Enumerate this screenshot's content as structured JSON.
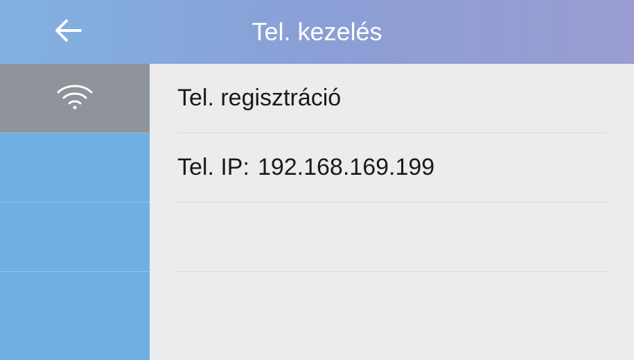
{
  "header": {
    "title": "Tel. kezelés"
  },
  "sidebar": {
    "items": [
      {
        "icon": "wifi",
        "selected": true
      }
    ]
  },
  "content": {
    "rows": [
      {
        "label": "Tel. regisztráció"
      },
      {
        "label": "Tel. IP:",
        "value": "192.168.169.199"
      }
    ]
  }
}
